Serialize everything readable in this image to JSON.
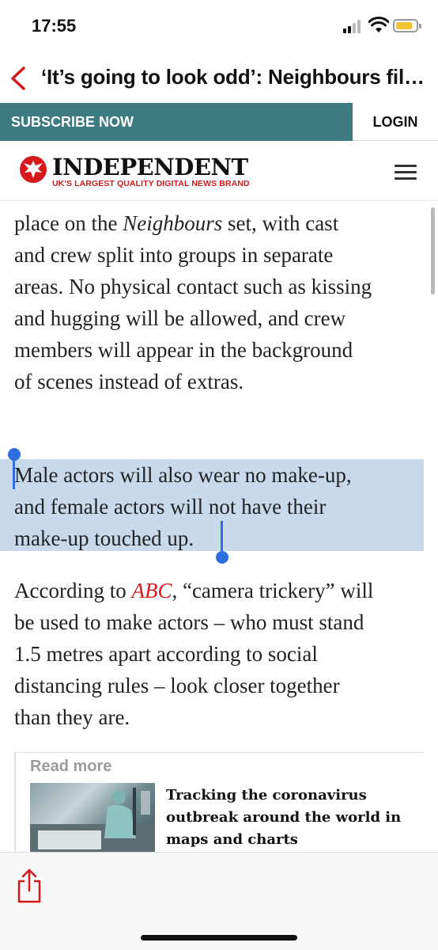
{
  "status_bar": {
    "time": "17:55",
    "signal_icon": "cellular-signal-icon",
    "wifi_icon": "wifi-icon",
    "battery_icon": "battery-icon",
    "battery_color": "#f2c530"
  },
  "nav": {
    "back_icon": "chevron-left-icon",
    "title": "‘It’s going to look odd’: Neighbours filming returns with strict social distancing rules",
    "accent_color": "#d7191c"
  },
  "subscribe_bar": {
    "subscribe_label": "SUBSCRIBE NOW",
    "login_label": "LOGIN",
    "bar_color": "#3d7b80"
  },
  "masthead": {
    "logo_icon": "eagle-logo-icon",
    "brand_name": "INDEPENDENT",
    "tagline": "UK'S LARGEST QUALITY DIGITAL NEWS BRAND",
    "menu_icon": "hamburger-menu-icon",
    "tagline_color": "#d7191c"
  },
  "article": {
    "para1": {
      "l0_start": "place on the ",
      "l0_em": "Neighbours",
      "l0_end": " set, with cast",
      "l1": "and crew split into groups in separate",
      "l2": "areas. No physical contact such as kissing",
      "l3": "and hugging will be allowed, and crew",
      "l4": "members will appear in the background",
      "l5": "of scenes instead of extras."
    },
    "para2": {
      "l0": "Male actors will also wear no make-up,",
      "l1": "and female actors will not have their",
      "l2": "make-up touched up."
    },
    "para3": {
      "l0_start": "According to ",
      "l0_link": "ABC",
      "l0_end": ", “camera trickery” will",
      "l1": "be used to make actors – who must stand",
      "l2": "1.5 metres apart according to social",
      "l3": "distancing rules – look closer together",
      "l4": "than they are."
    },
    "selection_color": "#c9d9ec",
    "selection_handle_color": "#2f6ee0"
  },
  "read_more": {
    "label": "Read more",
    "title": "Tracking the coronavirus outbreak around the world in maps and charts"
  },
  "bottom_bar": {
    "share_icon": "share-icon"
  }
}
